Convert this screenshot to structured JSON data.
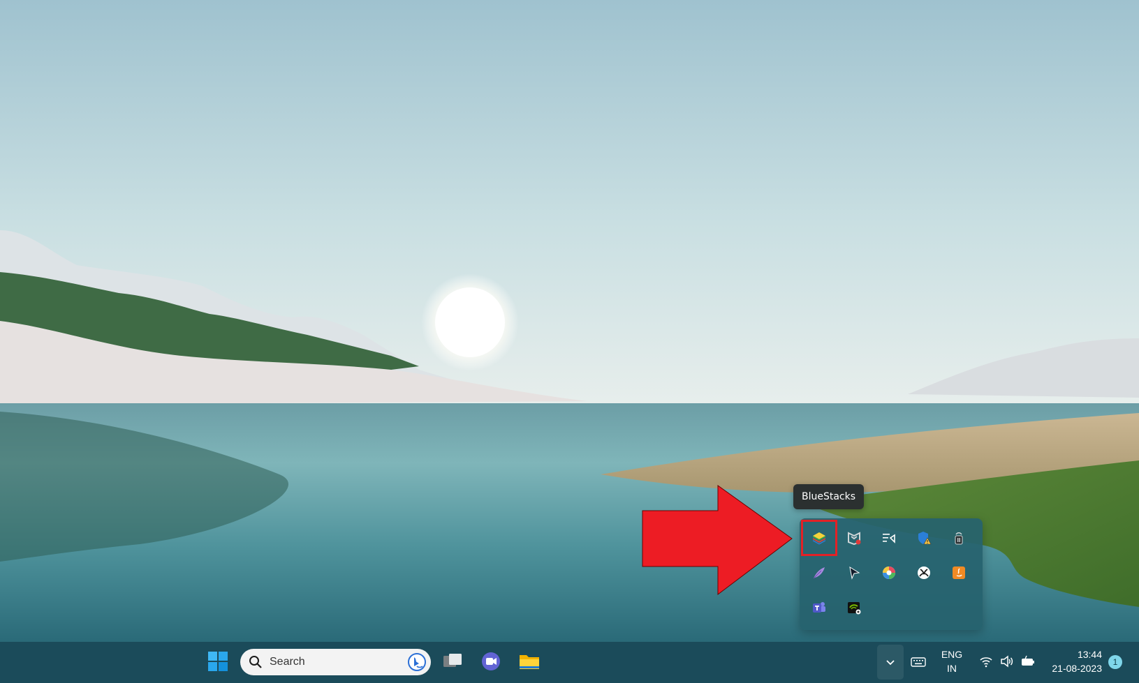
{
  "tooltip": {
    "text": "BlueStacks"
  },
  "tray_overflow": {
    "items": [
      {
        "icon": "bluestacks-icon",
        "highlighted": true
      },
      {
        "icon": "mcafee-icon",
        "highlighted": false
      },
      {
        "icon": "voice-access-icon",
        "highlighted": false
      },
      {
        "icon": "windows-security-warning-icon",
        "highlighted": false
      },
      {
        "icon": "router-icon",
        "highlighted": false
      },
      {
        "icon": "feather-pen-icon",
        "highlighted": false
      },
      {
        "icon": "cursor-icon",
        "highlighted": false
      },
      {
        "icon": "color-wheel-icon",
        "highlighted": false
      },
      {
        "icon": "xbox-icon",
        "highlighted": false
      },
      {
        "icon": "java-update-icon",
        "highlighted": false
      },
      {
        "icon": "teams-icon",
        "highlighted": false
      },
      {
        "icon": "nvidia-icon",
        "highlighted": false
      }
    ]
  },
  "taskbar": {
    "search_placeholder": "Search",
    "language_line1": "ENG",
    "language_line2": "IN",
    "time": "13:44",
    "date": "21-08-2023",
    "notification_count": "1"
  },
  "colors": {
    "taskbar_bg": "#1b4b5a",
    "annotation_red": "#e32126",
    "flyout_bg": "#26626e"
  }
}
